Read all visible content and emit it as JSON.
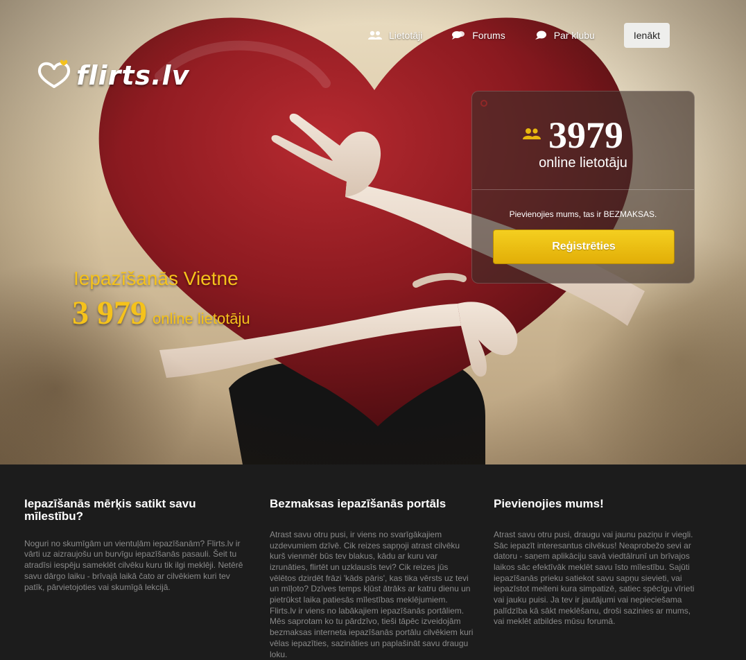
{
  "nav": {
    "items": [
      {
        "label": "Lietotāji",
        "icon": "users-icon"
      },
      {
        "label": "Forums",
        "icon": "chat-bubbles-icon"
      },
      {
        "label": "Par klubu",
        "icon": "speech-bubble-icon"
      }
    ],
    "login_label": "Ienākt"
  },
  "logo": {
    "text": "flirts.lv"
  },
  "hero": {
    "title": "Iepazīšanās Vietne",
    "count": "3 979",
    "count_label": "online lietotāju"
  },
  "stats": {
    "count": "3979",
    "label": "online lietotāju",
    "join_text": "Pievienojies mums, tas ir BEZMAKSAS.",
    "register_label": "Reģistrēties"
  },
  "columns": [
    {
      "title": "Iepazīšanās mērķis satikt savu mīlestību?",
      "text": "Noguri no skumīgām un vientuļām iepazīšanām? Flirts.lv ir vārti uz aizraujošu un burvīgu iepazīšanās pasauli. Šeit tu atradīsi iespēju sameklēt cilvēku kuru tik ilgi meklēji. Netērē savu dārgo laiku - brīvajā laikā čato ar cilvēkiem kuri tev patīk, pārvietojoties vai skumīgā lekcijā."
    },
    {
      "title": "Bezmaksas iepazīšanās portāls",
      "text": "Atrast savu otru pusi, ir viens no svarīgākajiem uzdevumiem dzīvē. Cik reizes sapņoji atrast cilvēku kurš vienmēr būs tev blakus, kādu ar kuru var izrunāties, flirtēt un uzklausīs tevi? Cik reizes jūs vēlētos dzirdēt frāzi 'kāds pāris', kas tika vērsts uz tevi un mīļoto? Dzīves temps kļūst ātrāks ar katru dienu un pietrūkst laika patiesās mīlestības meklējumiem. Flirts.lv ir viens no labākajiem iepazīšanās portāliem. Mēs saprotam ko tu pārdzīvo, tieši tāpēc izveidojām bezmaksas interneta iepazīšanās portālu cilvēkiem kuri vēlas iepazīties, sazināties un paplašināt savu draugu loku."
    },
    {
      "title": "Pievienojies mums!",
      "text": "Atrast savu otru pusi, draugu vai jaunu paziņu ir viegli. Sāc iepazīt interesantus cilvēkus! Neaprobežo sevi ar datoru - saņem aplikāciju savā viedtālrunī un brīvajos laikos sāc efektīvāk meklēt savu īsto mīlestību. Sajūti iepazīšanās prieku satiekot savu sapņu sievieti, vai iepazīstot meiteni kura simpatizē, satiec spēcīgu vīrieti vai jauku puisi. Ja tev ir jautājumi vai nepieciešama palīdzība kā sākt meklēšanu, droši sazinies ar mums, vai meklēt atbildes mūsu forumā."
    }
  ],
  "colors": {
    "accent": "#f5c21b",
    "register_button": "#e8b80f",
    "heart": "#8e1a20",
    "footer_bg": "#1c1c1c"
  }
}
